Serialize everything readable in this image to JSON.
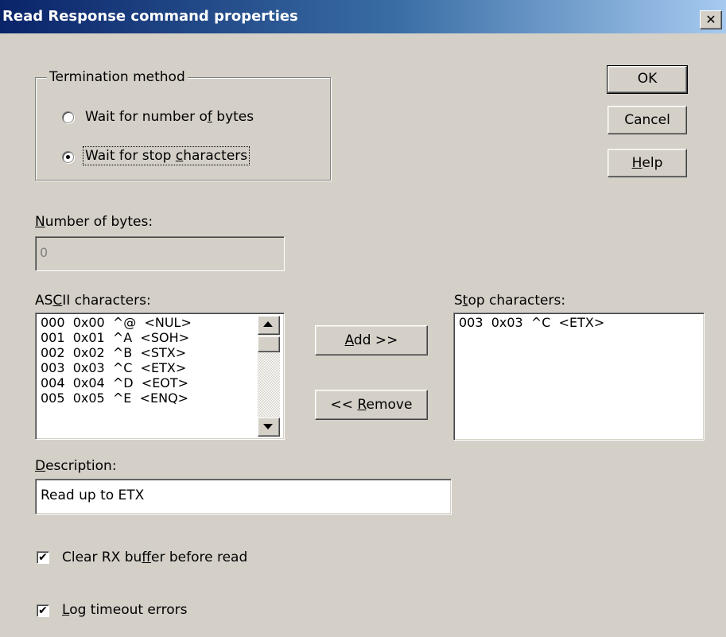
{
  "dialog": {
    "title": "Read Response command properties",
    "close_glyph": "✕"
  },
  "termination": {
    "legend": "Termination method",
    "options": [
      {
        "label": "Wait for number of bytes",
        "selected": false
      },
      {
        "label": "Wait for stop characters",
        "selected": true
      }
    ]
  },
  "buttons": {
    "ok": "OK",
    "cancel": "Cancel",
    "help": "Help",
    "add": "Add >>",
    "remove": "<< Remove"
  },
  "number_of_bytes": {
    "label": "Number of bytes:",
    "value": "0",
    "disabled": true
  },
  "ascii": {
    "label": "ASCII characters:",
    "items": [
      "000  0x00  ^@  <NUL>",
      "001  0x01  ^A  <SOH>",
      "002  0x02  ^B  <STX>",
      "003  0x03  ^C  <ETX>",
      "004  0x04  ^D  <EOT>",
      "005  0x05  ^E  <ENQ>"
    ]
  },
  "stop_characters": {
    "label": "Stop characters:",
    "items": [
      "003  0x03  ^C  <ETX>"
    ]
  },
  "description": {
    "label": "Description:",
    "value": "Read up to ETX"
  },
  "options": {
    "clear_rx": {
      "label": "Clear RX buffer before read",
      "checked": true
    },
    "log_timeout": {
      "label": "Log timeout errors",
      "checked": true
    }
  },
  "icons": {
    "check": "✔",
    "scroll_up": "scroll-up-arrow-icon",
    "scroll_down": "scroll-down-arrow-icon"
  },
  "colors": {
    "title_start": "#0a246a",
    "title_end": "#a6caf0",
    "face": "#d4d0c8"
  }
}
